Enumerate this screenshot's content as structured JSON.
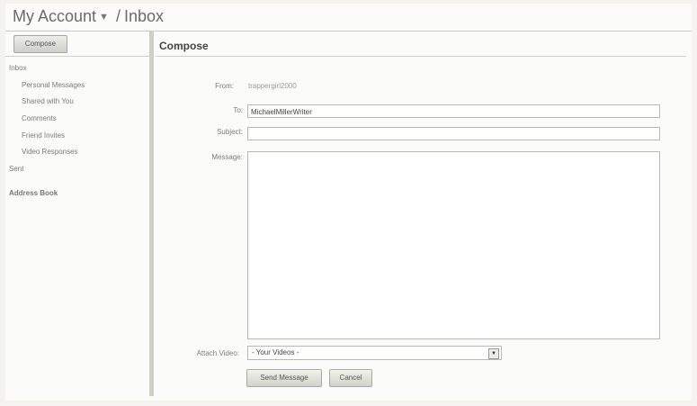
{
  "header": {
    "account_label": "My Account",
    "account_caret": "▼",
    "separator": "/",
    "section": "Inbox"
  },
  "sidebar": {
    "compose_label": "Compose",
    "items": [
      {
        "label": "Inbox",
        "level": 0
      },
      {
        "label": "Personal Messages",
        "level": 1
      },
      {
        "label": "Shared with You",
        "level": 1
      },
      {
        "label": "Comments",
        "level": 1
      },
      {
        "label": "Friend Invites",
        "level": 1
      },
      {
        "label": "Video Responses",
        "level": 1
      },
      {
        "label": "Sent",
        "level": 0
      }
    ],
    "address_book": "Address Book"
  },
  "main": {
    "heading": "Compose",
    "from_label": "From:",
    "from_value": "trappergirl2000",
    "to_label": "To:",
    "to_value": "MichaelMillerWriter",
    "subject_label": "Subject:",
    "subject_value": "",
    "message_label": "Message:",
    "message_value": "",
    "attach_label": "Attach Video:",
    "attach_selected": "- Your Videos -",
    "send_label": "Send Message",
    "cancel_label": "Cancel"
  }
}
